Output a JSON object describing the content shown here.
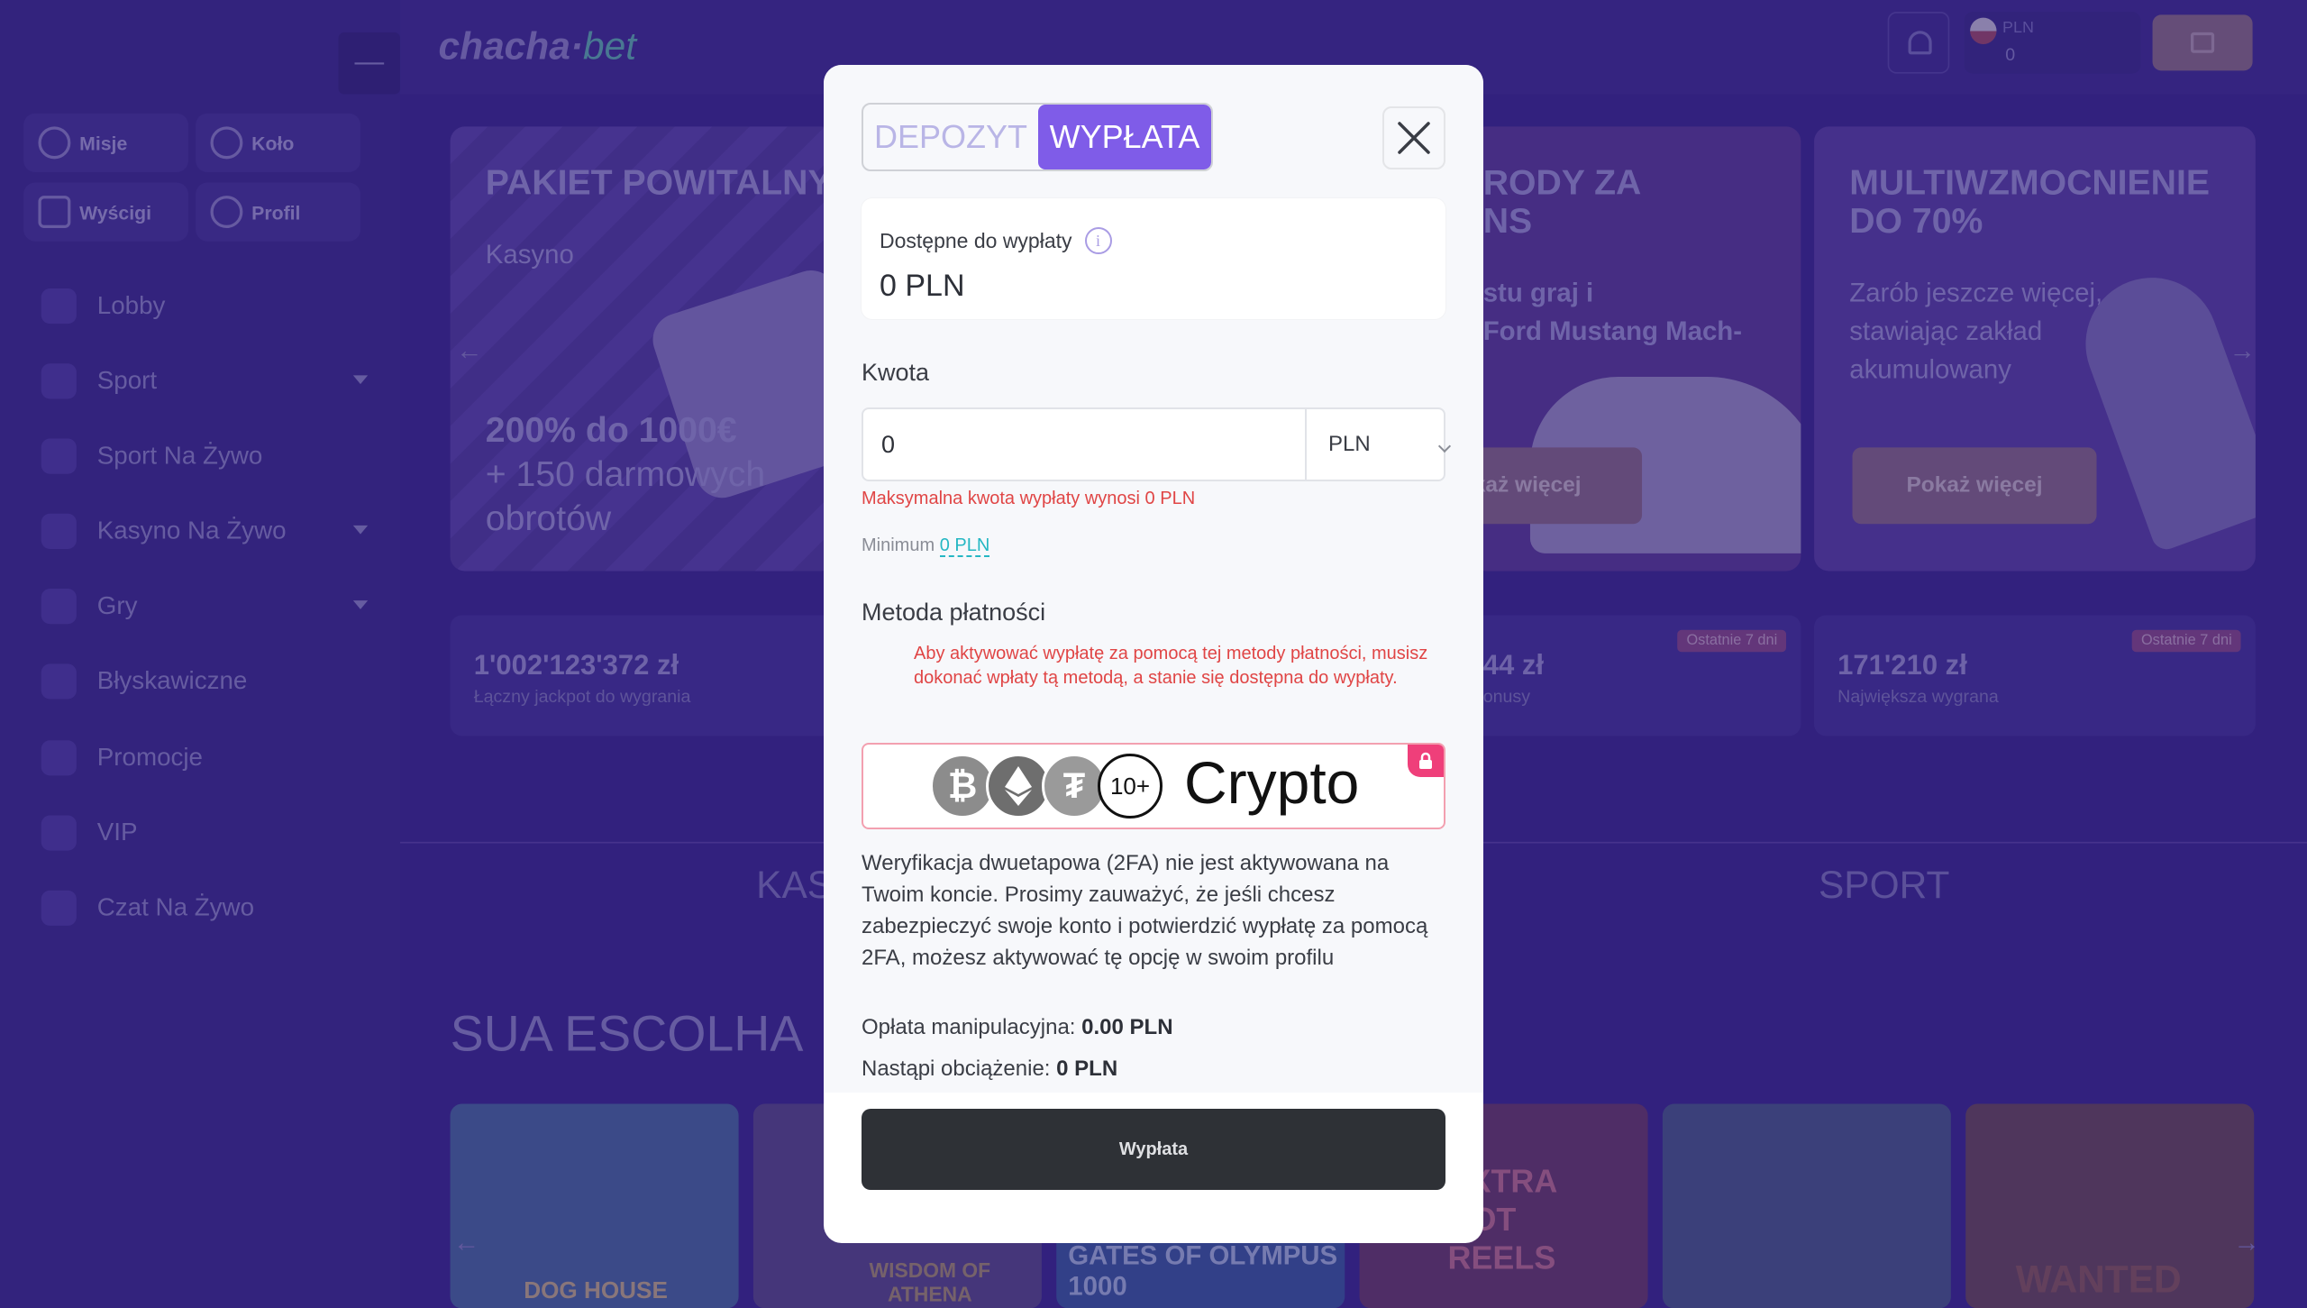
{
  "app": {
    "logo_main": "chacha",
    "logo_suffix": "bet",
    "collapse_symbol": "—",
    "currency": "PLN",
    "balance": "0"
  },
  "sidebar": {
    "quick": [
      {
        "label": "Misje",
        "icon": "target-icon"
      },
      {
        "label": "Koło",
        "icon": "wheel-icon"
      },
      {
        "label": "Wyścigi",
        "icon": "trophy-icon"
      },
      {
        "label": "Profil",
        "icon": "user-icon"
      }
    ],
    "items": [
      {
        "label": "Lobby"
      },
      {
        "label": "Sport"
      },
      {
        "label": "Sport Na Żywo"
      },
      {
        "label": "Kasyno Na Żywo"
      },
      {
        "label": "Gry"
      },
      {
        "label": "Błyskawiczne"
      },
      {
        "label": "Promocje"
      },
      {
        "label": "VIP"
      },
      {
        "label": "Czat Na Żywo"
      }
    ]
  },
  "banners": [
    {
      "title": "PAKIET POWITALNY",
      "sub": "Kasyno",
      "body_1": "200% do 1000€",
      "body_2": "+ 150 darmowych",
      "body_3": "obrotów"
    },
    {
      "title_1": "RODY ZA",
      "title_2": "NS",
      "body_1": "stu graj i",
      "body_2": "Ford Mustang Mach-",
      "button": "każ więcej"
    },
    {
      "title_1": "MULTIWZMOCNIENIE",
      "title_2": "DO 70%",
      "body_1": "Zarób jeszcze więcej,",
      "body_2": "stawiając zakład",
      "body_3": "akumulowany",
      "button": "Pokaż więcej"
    }
  ],
  "stats": [
    {
      "value": "1'002'123'372 zł",
      "label": "Łączny jackpot do wygrania"
    },
    {
      "value": "44 zł",
      "label": "onusy",
      "tag": "Ostatnie 7 dni"
    },
    {
      "value": "171'210 zł",
      "label": "Największa wygrana",
      "tag": "Ostatnie 7 dni"
    }
  ],
  "tabs_bg": {
    "left": "KAS",
    "right": "SPORT"
  },
  "section_title": "SUA ESCOLHA",
  "games": [
    "DOG HOUSE",
    "WISDOM OF ATHENA",
    "GATES OF OLYMPUS 1000",
    "EXTRA HOT REELS",
    "",
    "WANTED"
  ],
  "modal": {
    "tab_deposit": "DEPOZYT",
    "tab_withdraw": "WYPŁATA",
    "available_label": "Dostępne do wypłaty",
    "available_value": "0 PLN",
    "amount_label": "Kwota",
    "amount_value": "0",
    "currency": "PLN",
    "error": "Maksymalna kwota wypłaty wynosi 0 PLN",
    "minimum_label": "Minimum",
    "minimum_value": "0 PLN",
    "method_label": "Metoda płatności",
    "method_warning": "Aby aktywować wypłatę za pomocą tej metody płatności, musisz dokonać wpłaty tą metodą, a stanie się dostępna do wypłaty.",
    "crypto_more": "10+",
    "crypto_label": "Crypto",
    "twofa_text": "Weryfikacja dwuetapowa (2FA) nie jest aktywowana na Twoim koncie. Prosimy zauważyć, że jeśli chcesz zabezpieczyć swoje konto i potwierdzić wypłatę za pomocą 2FA, możesz aktywować tę opcję w swoim profilu",
    "fee_label": "Opłata manipulacyjna:",
    "fee_value": "0.00 PLN",
    "charge_label": "Nastąpi obciążenie:",
    "charge_value": "0 PLN",
    "submit": "Wypłata"
  },
  "colors": {
    "accent": "#7f5ce8",
    "error": "#e04545",
    "link": "#25b7c3",
    "submit_bg": "#2e3136"
  }
}
